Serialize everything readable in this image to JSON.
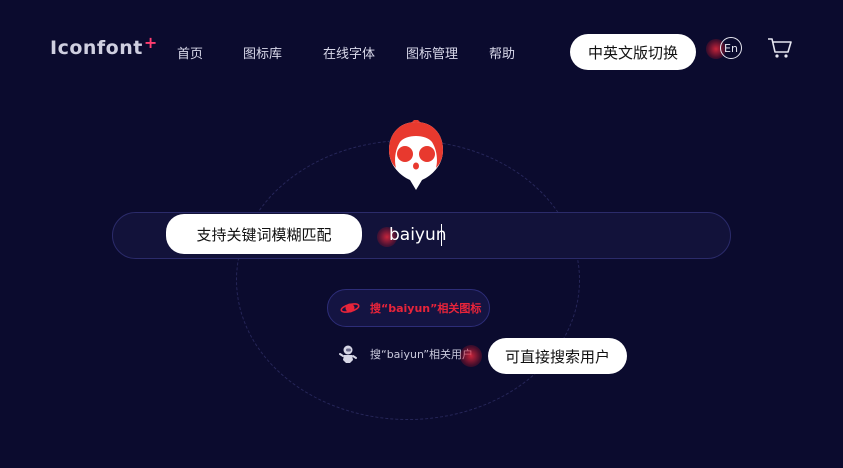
{
  "header": {
    "logo_text": "Iconfont",
    "logo_plus": "+",
    "nav": [
      {
        "label": "首页"
      },
      {
        "label": "图标库"
      },
      {
        "label": "在线字体"
      },
      {
        "label": "图标管理"
      },
      {
        "label": "帮助"
      }
    ],
    "lang_switch_tooltip": "中英文版切换",
    "lang_button": "En",
    "cart_icon": "cart-icon"
  },
  "search": {
    "tooltip": "支持关键词模糊匹配",
    "value": "baiyun",
    "suggestions": {
      "icons_label": "搜“baiyun”相关图标",
      "users_label": "搜“baiyun”相关用户",
      "users_tooltip": "可直接搜索用户"
    }
  },
  "colors": {
    "background": "#0b0b2e",
    "accent_red": "#e8243a",
    "logo_plus": "#ff3d70"
  }
}
